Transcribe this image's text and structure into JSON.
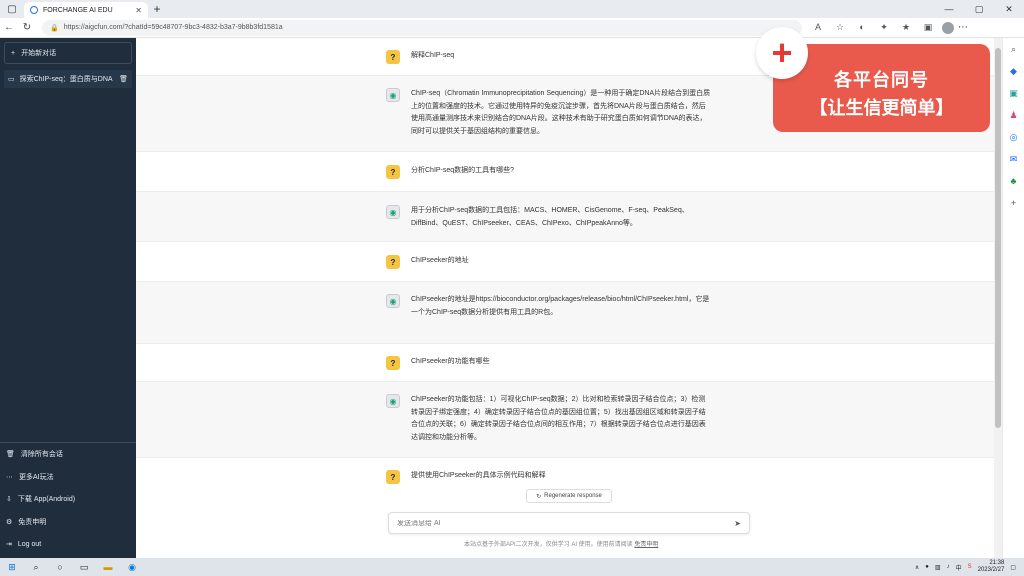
{
  "browser": {
    "tab_title": "FORCHANGE AI EDU",
    "tab_close": "✕",
    "new_tab": "+",
    "url": "https://aigcfun.com/?chatId=59c48707-9bc3-4832-b3a7-9b8b3fd1581a"
  },
  "sidebar": {
    "new_chat": "开始新对话",
    "conversations": [
      {
        "label": "探索ChIP-seq：蛋白质与DNA"
      }
    ],
    "bottom_items": [
      {
        "icon": "trash-icon",
        "label": "清除所有会话"
      },
      {
        "icon": "more-icon",
        "label": "更多AI玩法"
      },
      {
        "icon": "download-icon",
        "label": "下载 App(Android)"
      },
      {
        "icon": "disclaimer-icon",
        "label": "免责申明"
      },
      {
        "icon": "logout-icon",
        "label": "Log out"
      }
    ]
  },
  "messages": [
    {
      "role": "user",
      "text": "解释ChIP-seq"
    },
    {
      "role": "ai",
      "text": "ChIP-seq（Chromatin Immunoprecipitation Sequencing）是一种用于确定DNA片段结合到蛋白质上的位置和强度的技术。它通过使用特异的免疫沉淀步骤，首先将DNA片段与蛋白质结合，然后使用高通量测序技术来识别结合的DNA片段。这种技术有助于研究蛋白质如何调节DNA的表达，同时可以提供关于基因组结构的重要信息。"
    },
    {
      "role": "user",
      "text": "分析ChIP-seq数据的工具有哪些?"
    },
    {
      "role": "ai",
      "text": "用于分析ChIP-seq数据的工具包括：MACS、HOMER、CisGenome、F-seq、PeakSeq、DiffBind、QuEST、ChIPseeker、CEAS、ChIPexo、ChIPpeakAnno等。"
    },
    {
      "role": "user",
      "text": "ChIPseeker的地址"
    },
    {
      "role": "ai",
      "text": "ChIPseeker的地址是https://bioconductor.org/packages/release/bioc/html/ChIPseeker.html，它是一个为ChIP-seq数据分析提供有用工具的R包。"
    },
    {
      "role": "user",
      "text": "ChIPseeker的功能有哪些"
    },
    {
      "role": "ai",
      "text": "ChIPseeker的功能包括：1）可视化ChIP-seq数据；2）比对和检索转录因子结合位点；3）检测转录因子绑定强度；4）确定转录因子结合位点的基因组位置；5）找出基因组区域和转录因子结合位点的关联；6）确定转录因子结合位点间的相互作用；7）根据转录因子结合位点进行基因表达调控和功能分析等。"
    },
    {
      "role": "user",
      "text": "提供使用ChIPseeker的具体示例代码和解释"
    }
  ],
  "regenerate_label": "Regenerate response",
  "input": {
    "placeholder": "发送消息给 AI"
  },
  "footer_note": "本站点基于外部API二次开发，仅供学习 AI 使用。使用前请阅读",
  "footer_link": "免责申明",
  "banner": {
    "line1": "各平台同号",
    "line2": "【让生信更简单】"
  },
  "taskbar": {
    "time": "21:38",
    "date": "2023/2/27"
  },
  "colors": {
    "sidebar": "#1f2d3d",
    "banner": "#e95a4c",
    "plus": "#e53935"
  }
}
